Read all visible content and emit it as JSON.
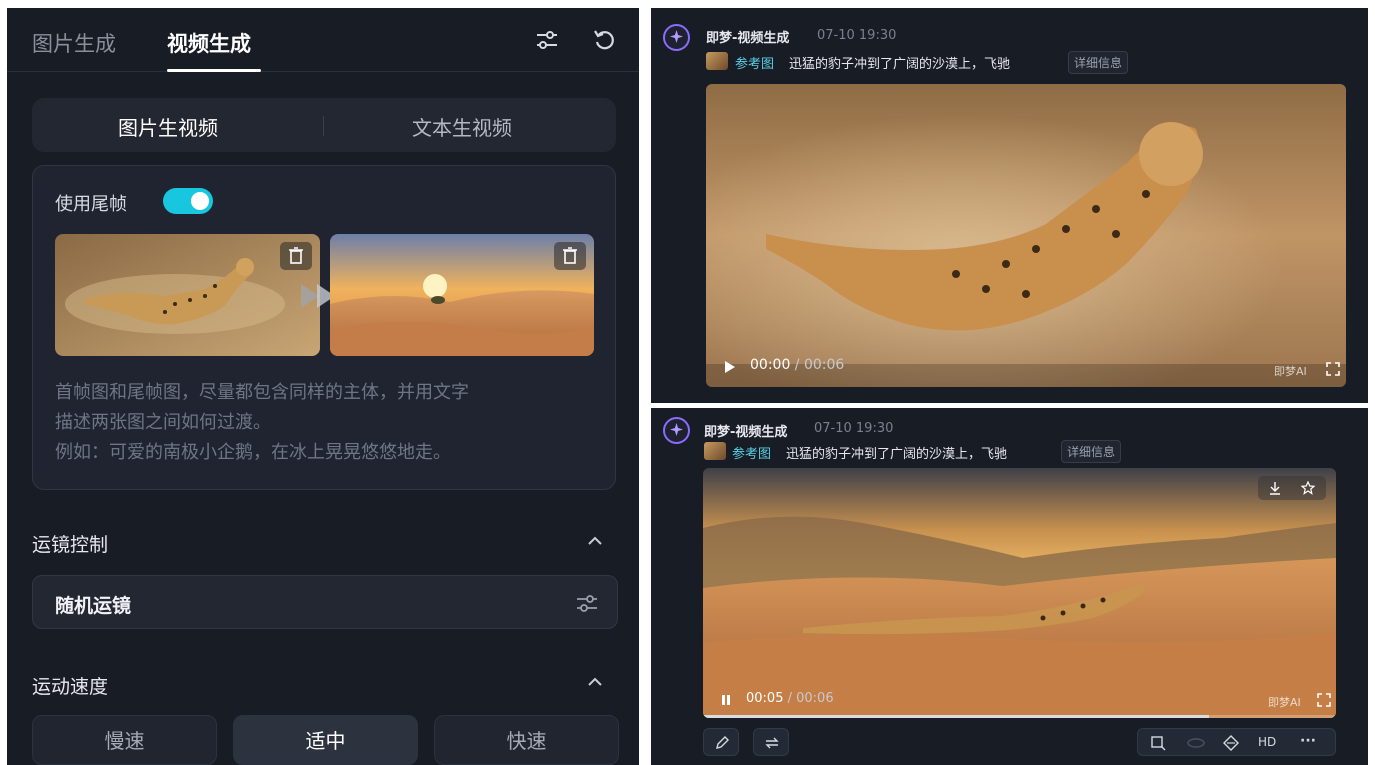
{
  "left_panel": {
    "tabs": [
      {
        "label": "图片生成",
        "active": false
      },
      {
        "label": "视频生成",
        "active": true
      }
    ],
    "mode_switch": {
      "options": [
        "图片生视频",
        "文本生视频"
      ],
      "selected": "图片生视频"
    },
    "end_frame": {
      "toggle_label": "使用尾帧",
      "enabled": true,
      "hint_line1": "首帧图和尾帧图，尽量都包含同样的主体，并用文字",
      "hint_line2": "描述两张图之间如何过渡。",
      "hint_line3": "例如：可爱的南极小企鹅，在冰上晃晃悠悠地走。"
    },
    "camera": {
      "title": "运镜控制",
      "value": "随机运镜"
    },
    "speed": {
      "title": "运动速度",
      "options": [
        "慢速",
        "适中",
        "快速"
      ],
      "selected": "适中"
    }
  },
  "results": [
    {
      "title": "即梦-视频生成",
      "time": "07-10  19:30",
      "ref_label": "参考图",
      "prompt": "迅猛的豹子冲到了广阔的沙漠上，飞驰",
      "detail_label": "详细信息",
      "current": "00:00",
      "separator": " / ",
      "duration": "00:06",
      "watermark": "即梦AI",
      "playing": false,
      "progress": 0
    },
    {
      "title": "即梦-视频生成",
      "time": "07-10  19:30",
      "ref_label": "参考图",
      "prompt": "迅猛的豹子冲到了广阔的沙漠上，飞驰",
      "detail_label": "详细信息",
      "current": "00:05",
      "separator": " / ",
      "duration": "00:06",
      "watermark": "即梦AI",
      "playing": true,
      "progress": 0.8,
      "toolbar_hd": "HD",
      "toolbar_more": "···"
    }
  ],
  "colors": {
    "accent": "#18c6df",
    "panel_bg": "#181c25",
    "brand": "#8c6cff"
  }
}
